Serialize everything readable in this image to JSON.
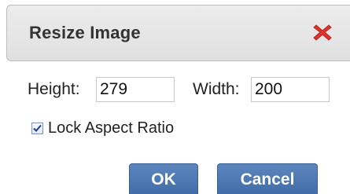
{
  "dialog": {
    "title": "Resize Image",
    "close_icon": "close-icon",
    "close_color": "#e0332b"
  },
  "size": {
    "height_label": "Height:",
    "height_value": "279",
    "width_label": "Width:",
    "width_value": "200"
  },
  "lock": {
    "label": "Lock Aspect Ratio",
    "checked": true
  },
  "buttons": {
    "ok_label": "OK",
    "cancel_label": "Cancel",
    "color": "#4a74ad"
  }
}
